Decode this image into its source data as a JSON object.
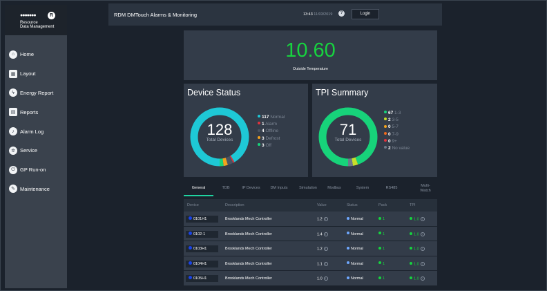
{
  "brand": {
    "line1": "Resource",
    "line2": "Data Management",
    "seal": "R"
  },
  "sidebar": {
    "items": [
      {
        "label": "Home",
        "icon": "home-icon",
        "glyph": "⌂"
      },
      {
        "label": "Layout",
        "icon": "layout-icon",
        "glyph": "▦"
      },
      {
        "label": "Energy Report",
        "icon": "energy-icon",
        "glyph": "ϟ"
      },
      {
        "label": "Reports",
        "icon": "reports-icon",
        "glyph": "▤"
      },
      {
        "label": "Alarm Log",
        "icon": "bell-icon",
        "glyph": "♪"
      },
      {
        "label": "Service",
        "icon": "gear-icon",
        "glyph": "✲"
      },
      {
        "label": "GP Run-on",
        "icon": "power-icon",
        "glyph": "⏻"
      },
      {
        "label": "Maintenance",
        "icon": "wrench-icon",
        "glyph": "✎"
      }
    ]
  },
  "header": {
    "title": "RDM DMTouch Alarms & Monitoring",
    "time": "13:43",
    "date": "11/03/2019",
    "help": "?",
    "login": "Login"
  },
  "temperature": {
    "value": "10.60",
    "label": "Outside Temperature"
  },
  "device_status": {
    "title": "Device Status",
    "total": "128",
    "total_label": "Total Devices",
    "legend": [
      {
        "count": "117",
        "label": "Normal",
        "color": "#1ec8d6"
      },
      {
        "count": "1",
        "label": "Alarm",
        "color": "#e2333d"
      },
      {
        "count": "4",
        "label": "Offline",
        "color": "#4a5462"
      },
      {
        "count": "3",
        "label": "Defrost",
        "color": "#f3a21c"
      },
      {
        "count": "3",
        "label": "Off",
        "color": "#17d37a"
      }
    ]
  },
  "tpi_summary": {
    "title": "TPI Summary",
    "total": "71",
    "total_label": "Total Devices",
    "legend": [
      {
        "count": "67",
        "label": "1-3",
        "color": "#17d37a"
      },
      {
        "count": "2",
        "label": "3-5",
        "color": "#c7e02a"
      },
      {
        "count": "0",
        "label": "5-7",
        "color": "#f3a21c"
      },
      {
        "count": "0",
        "label": "7-9",
        "color": "#f06a1c"
      },
      {
        "count": "0",
        "label": "9+",
        "color": "#e2333d"
      },
      {
        "count": "2",
        "label": "No value",
        "color": "#6e7a8a"
      }
    ]
  },
  "tabs": [
    "General",
    "TDB",
    "IP Devices",
    "DM Inputs",
    "Simulation",
    "Modbus",
    "System",
    "RS485",
    "Multi-Watch"
  ],
  "table": {
    "headers": [
      "Device",
      "Description",
      "Value",
      "Status",
      "Pack",
      "TPI"
    ],
    "rows": [
      {
        "device": "0101H1",
        "description": "Brooklands Mech Controller",
        "value": "1.2",
        "status": "Normal",
        "pack": "1",
        "tpi": "1.0"
      },
      {
        "device": "0102-1",
        "description": "Brooklands Mech Controller",
        "value": "1.4",
        "status": "Normal",
        "pack": "1",
        "tpi": "1.0"
      },
      {
        "device": "0103H1",
        "description": "Brooklands Mech Controller",
        "value": "1.2",
        "status": "Normal",
        "pack": "1",
        "tpi": "1.0"
      },
      {
        "device": "0104H1",
        "description": "Brooklands Mech Controller",
        "value": "1.1",
        "status": "Normal",
        "pack": "1",
        "tpi": "1.0"
      },
      {
        "device": "0105H1",
        "description": "Brooklands Mech Controller",
        "value": "1.0",
        "status": "Normal",
        "pack": "1",
        "tpi": "1.0"
      }
    ]
  },
  "colors": {
    "accent": "#17d33f",
    "tab_underline": "#1fd3a0",
    "device_dot": "#1a44e8",
    "status_dot": "#6fa8ff"
  }
}
